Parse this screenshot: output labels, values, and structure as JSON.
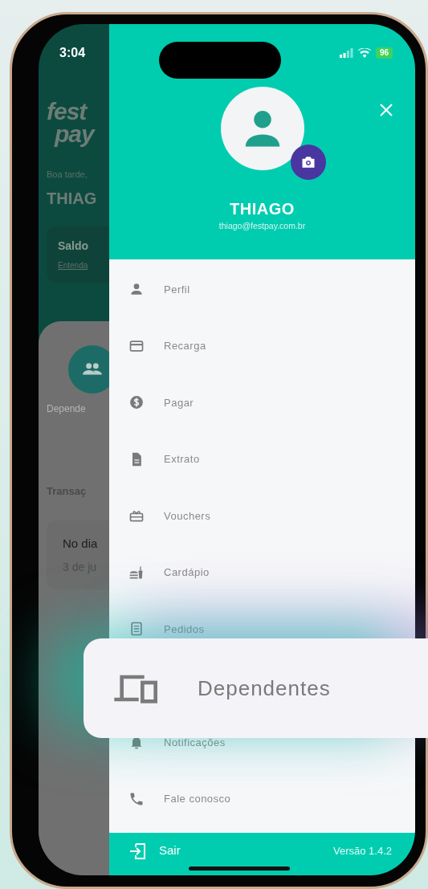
{
  "status_bar": {
    "time": "3:04",
    "battery": "96"
  },
  "background_screen": {
    "logo": [
      "fest",
      "pay"
    ],
    "greeting": "Boa tarde,",
    "name": "THIAG",
    "balance_card": {
      "title": "Saldo",
      "link": "Entenda"
    },
    "shortcut": {
      "label": "Depende"
    },
    "section_title": "Transaç",
    "transaction": {
      "title": "No dia",
      "date": "3 de ju"
    }
  },
  "drawer": {
    "user": {
      "name": "THIAGO",
      "email": "thiago@festpay.com.br"
    },
    "menu": [
      {
        "label": "Perfil",
        "kind": "profile",
        "highlighted": false
      },
      {
        "label": "Recarga",
        "kind": "card",
        "highlighted": false
      },
      {
        "label": "Pagar",
        "kind": "pay",
        "highlighted": false
      },
      {
        "label": "Extrato",
        "kind": "statement",
        "highlighted": false
      },
      {
        "label": "Vouchers",
        "kind": "voucher",
        "highlighted": false
      },
      {
        "label": "Cardápio",
        "kind": "food",
        "highlighted": false
      },
      {
        "label": "Pedidos",
        "kind": "orders",
        "highlighted": false
      },
      {
        "label": "Dependentes",
        "kind": "devices",
        "highlighted": true
      },
      {
        "label": "Notificações",
        "kind": "bell",
        "highlighted": false
      },
      {
        "label": "Fale conosco",
        "kind": "phone",
        "highlighted": false
      }
    ],
    "footer": {
      "logout": "Sair",
      "version": "Versão 1.4.2"
    }
  }
}
